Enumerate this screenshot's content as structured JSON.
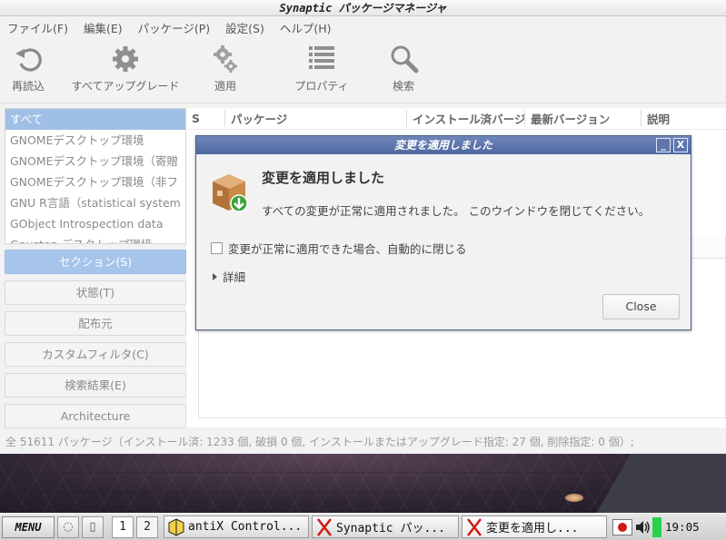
{
  "window": {
    "title": "Synaptic パッケージマネージャ"
  },
  "menu": [
    "ファイル(F)",
    "編集(E)",
    "パッケージ(P)",
    "設定(S)",
    "ヘルプ(H)"
  ],
  "toolbar": {
    "reload": "再読込",
    "upgrade_all": "すべてアップグレード",
    "apply": "適用",
    "properties": "プロパティ",
    "search": "検索"
  },
  "filters": [
    "すべて",
    "GNOMEデスクトップ環境",
    "GNOMEデスクトップ環境（寄贈",
    "GNOMEデスクトップ環境（非フ",
    "GNU R言語（statistical system",
    "GObject Introspection data",
    "Gnustep デスクトップ環境"
  ],
  "side_buttons": {
    "sections": "セクション(S)",
    "status": "状態(T)",
    "origin": "配布元",
    "custom": "カスタムフィルタ(C)",
    "search_results": "検索結果(E)",
    "architecture": "Architecture"
  },
  "columns": {
    "s": "S",
    "package": "パッケージ",
    "installed": "インストール済バージョン",
    "latest": "最新バージョン",
    "description": "説明"
  },
  "statusbar": "全 51611 パッケージ（インストール済: 1233 個, 破損 0 個, インストールまたはアップグレード指定: 27 個, 削除指定: 0 個）;",
  "dialog": {
    "title": "変更を適用しました",
    "minimize": "_",
    "close_x": "X",
    "heading": "変更を適用しました",
    "message": "すべての変更が正常に適用されました。 このウインドウを閉じてください。",
    "auto_close": "変更が正常に適用できた場合、自動的に閉じる",
    "details": "詳細",
    "close_button": "Close"
  },
  "taskbar": {
    "menu": "MENU",
    "desktops": [
      "1",
      "2"
    ],
    "tasks": [
      "antiX Control...",
      "Synaptic パッ...",
      "変更を適用し..."
    ],
    "clock": "19:05"
  },
  "colors": {
    "selection": "#9fbfe6",
    "dialog_title": "#5a71a8",
    "battery": "#29d14a"
  }
}
